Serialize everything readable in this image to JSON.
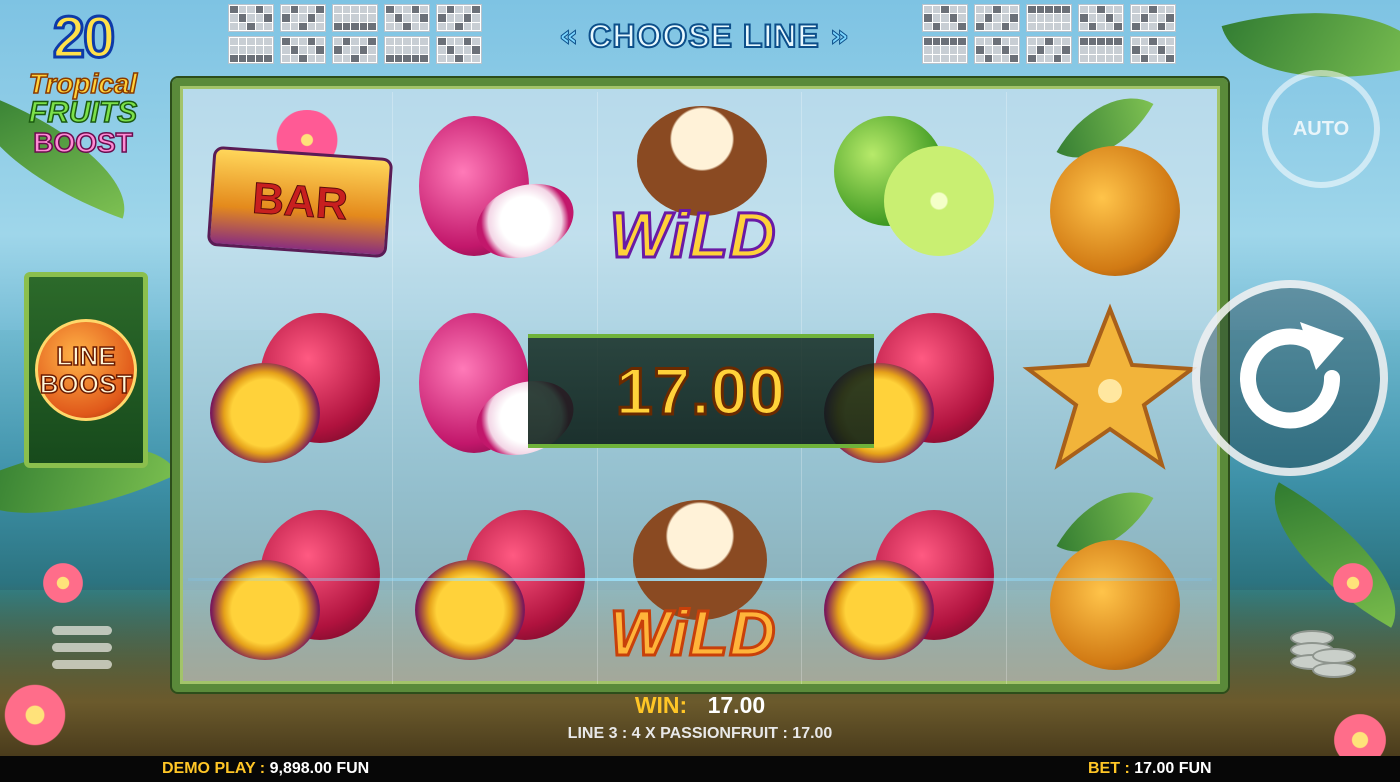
{
  "game": {
    "logo": {
      "number": "20",
      "line1": "Tropical",
      "line2": "FRUITS",
      "line3": "BOOST"
    },
    "choose_line": {
      "label": "CHOOSE LINE",
      "left_arrow": "«",
      "right_arrow": "»"
    },
    "line_boost": {
      "line1": "LINE",
      "line2": "BOOST"
    },
    "auto_label": "AUTO"
  },
  "reels": [
    [
      "bar",
      "dragonfruit",
      "wild",
      "lime",
      "pineapple"
    ],
    [
      "passionfruit",
      "dragonfruit",
      "wild",
      "passionfruit",
      "starfruit"
    ],
    [
      "passionfruit",
      "passionfruit",
      "wild",
      "passionfruit",
      "pineapple"
    ]
  ],
  "symbols": {
    "bar_text": "BAR",
    "wild_text": "WiLD"
  },
  "win_banner": "17.00",
  "win_info": {
    "win_label": "WIN:",
    "win_value": "17.00",
    "line_text": "LINE 3 : 4 X PASSIONFRUIT : 17.00"
  },
  "status_bar": {
    "demo_label": "DEMO PLAY :",
    "balance": "9,898.00 FUN",
    "bet_label": "BET :",
    "bet": "17.00 FUN"
  },
  "colors": {
    "gold": "#ffc626",
    "frame_green": "#5a8a3a",
    "wild_purple": "#6a1aa5"
  },
  "icons": [
    "menu-icon",
    "coins-icon",
    "spin-icon",
    "auto-icon"
  ]
}
